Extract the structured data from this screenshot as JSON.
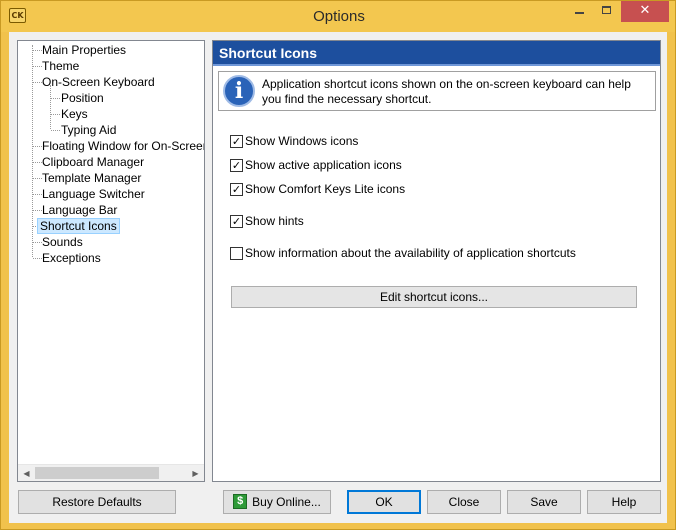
{
  "window": {
    "title": "Options",
    "app_icon_text": "CK",
    "close_symbol": "✕"
  },
  "tree": {
    "items": [
      {
        "label": "Main Properties"
      },
      {
        "label": "Theme"
      },
      {
        "label": "On-Screen Keyboard"
      },
      {
        "label": "Position"
      },
      {
        "label": "Keys"
      },
      {
        "label": "Typing Aid"
      },
      {
        "label": "Floating Window for On-Screen Ke"
      },
      {
        "label": "Clipboard Manager"
      },
      {
        "label": "Template Manager"
      },
      {
        "label": "Language Switcher"
      },
      {
        "label": "Language Bar"
      },
      {
        "label": "Shortcut Icons"
      },
      {
        "label": "Sounds"
      },
      {
        "label": "Exceptions"
      }
    ],
    "selected": "Shortcut Icons"
  },
  "panel": {
    "header": "Shortcut Icons",
    "info_text": "Application shortcut icons shown on the on-screen keyboard can help you find the necessary shortcut.",
    "checkboxes": [
      {
        "label": "Show Windows icons",
        "checked": true
      },
      {
        "label": "Show active application icons",
        "checked": true
      },
      {
        "label": "Show Comfort Keys Lite icons",
        "checked": true
      },
      {
        "label": "Show hints",
        "checked": true
      },
      {
        "label": "Show information about the availability of application shortcuts",
        "checked": false
      }
    ],
    "edit_button": "Edit shortcut icons..."
  },
  "buttons": {
    "restore_defaults": "Restore Defaults",
    "buy_online": "Buy Online...",
    "ok": "OK",
    "close": "Close",
    "save": "Save",
    "help": "Help"
  },
  "colors": {
    "titlebar": "#f3c74f",
    "panel_header": "#1d4f9e",
    "selection": "#cce8ff",
    "close_button": "#c75050"
  }
}
